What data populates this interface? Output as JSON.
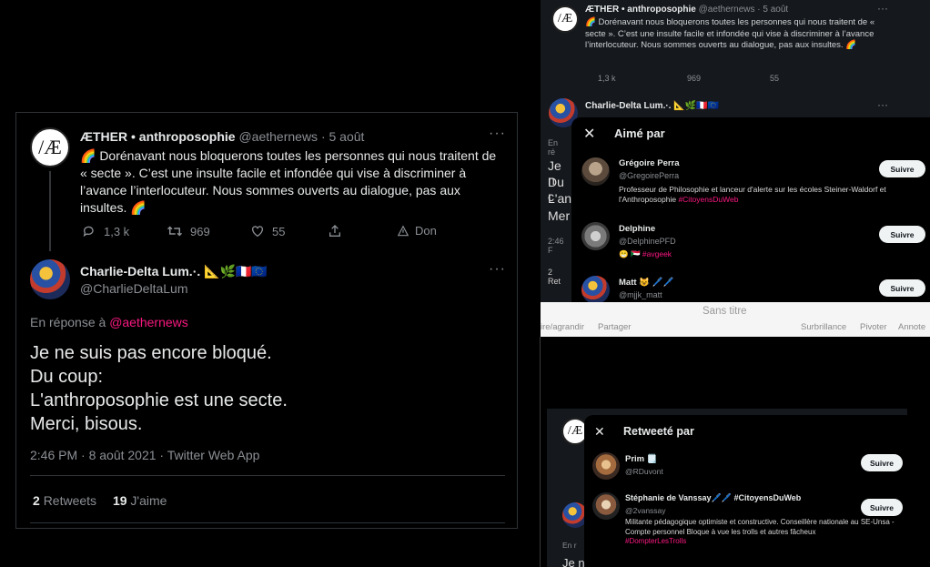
{
  "main_tweet": {
    "author_name": "ÆTHER • anthroposophie",
    "handle": "@aethernews",
    "time": "· 5 août",
    "avatar_text": "/Æ",
    "body": "🌈 Dorénavant nous bloquerons toutes les personnes qui nous traitent de « secte ». C’est une insulte facile et infondée qui vise à discriminer à l’avance l’interlocuteur. Nous sommes ouverts au dialogue, pas aux insultes. 🌈",
    "replies": "1,3 k",
    "retweets": "969",
    "likes": "55",
    "donate": "Don"
  },
  "reply_tweet": {
    "author_name": "Charlie-Delta Lum.·. 📐🌿🇫🇷🇪🇺",
    "handle": "@CharlieDeltaLum",
    "reply_prefix": "En réponse à",
    "reply_to": "@aethernews",
    "lines": [
      "Je ne suis pas encore bloqué.",
      "Du coup:",
      "L'anthroposophie est une secte.",
      "Merci, bisous."
    ],
    "meta": "2:46 PM · 8 août 2021 · Twitter Web App",
    "retweet_count": "2",
    "retweet_label": "Retweets",
    "like_count": "19",
    "like_label": "J'aime"
  },
  "right_top": {
    "author_name": "ÆTHER • anthroposophie",
    "handle_time": "@aethernews · 5 août",
    "body": "🌈 Dorénavant nous bloquerons toutes les personnes qui nous traitent de « secte ». C’est une insulte facile et infondée qui vise à discriminer à l’avance l’interlocuteur. Nous sommes ouverts au dialogue, pas aux insultes. 🌈",
    "replies": "1,3 k",
    "retweets": "969",
    "likes": "55",
    "reply_author": "Charlie-Delta Lum.·. 📐🌿🇫🇷🇪🇺",
    "side_lines": [
      "En ré",
      "Je n",
      "Du c",
      "L'an",
      "Mer",
      "2:46 F",
      "2 Ret"
    ]
  },
  "liked_modal": {
    "title": "Aimé par",
    "users": [
      {
        "name": "Grégoire Perra",
        "handle": "@GregoirePerra",
        "bio": "Professeur de Philosophie et lanceur d'alerte sur les écoles Steiner-Waldorf et l'Anthroposophie",
        "tag": "#CitoyensDuWeb",
        "button": "Suivre"
      },
      {
        "name": "Delphine",
        "handle": "@DelphinePFD",
        "bio": "😁 🇸🇩",
        "tag": "#avgeek",
        "button": "Suivre"
      },
      {
        "name": "Matt 😺 🖊️🖊️",
        "handle": "@mjjk_matt",
        "bio": "",
        "tag": "",
        "button": "Suivre"
      }
    ]
  },
  "preview_toolbar": {
    "title": "Sans titre",
    "left_items": [
      "ire/agrandir",
      "Partager"
    ],
    "right_items": [
      "Surbrillance",
      "Pivoter",
      "Annote"
    ]
  },
  "retweeted_modal": {
    "title": "Retweeté par",
    "users": [
      {
        "name": "Prim 🗒️",
        "handle": "@RDuvont",
        "bio": "",
        "tag": "",
        "button": "Suivre"
      },
      {
        "name": "Stéphanie de Vanssay🖊️🖊️ #CitoyensDuWeb",
        "handle": "@2vanssay",
        "bio": "Militante pédagogique optimiste et constructive. Conseillère nationale au SE-Unsa - Compte personnel Bloque à vue les trolls et autres fâcheux",
        "tag": "#DompterLesTrolls",
        "button": "Suivre"
      }
    ],
    "side_lines": [
      "En r",
      "Je n"
    ]
  }
}
